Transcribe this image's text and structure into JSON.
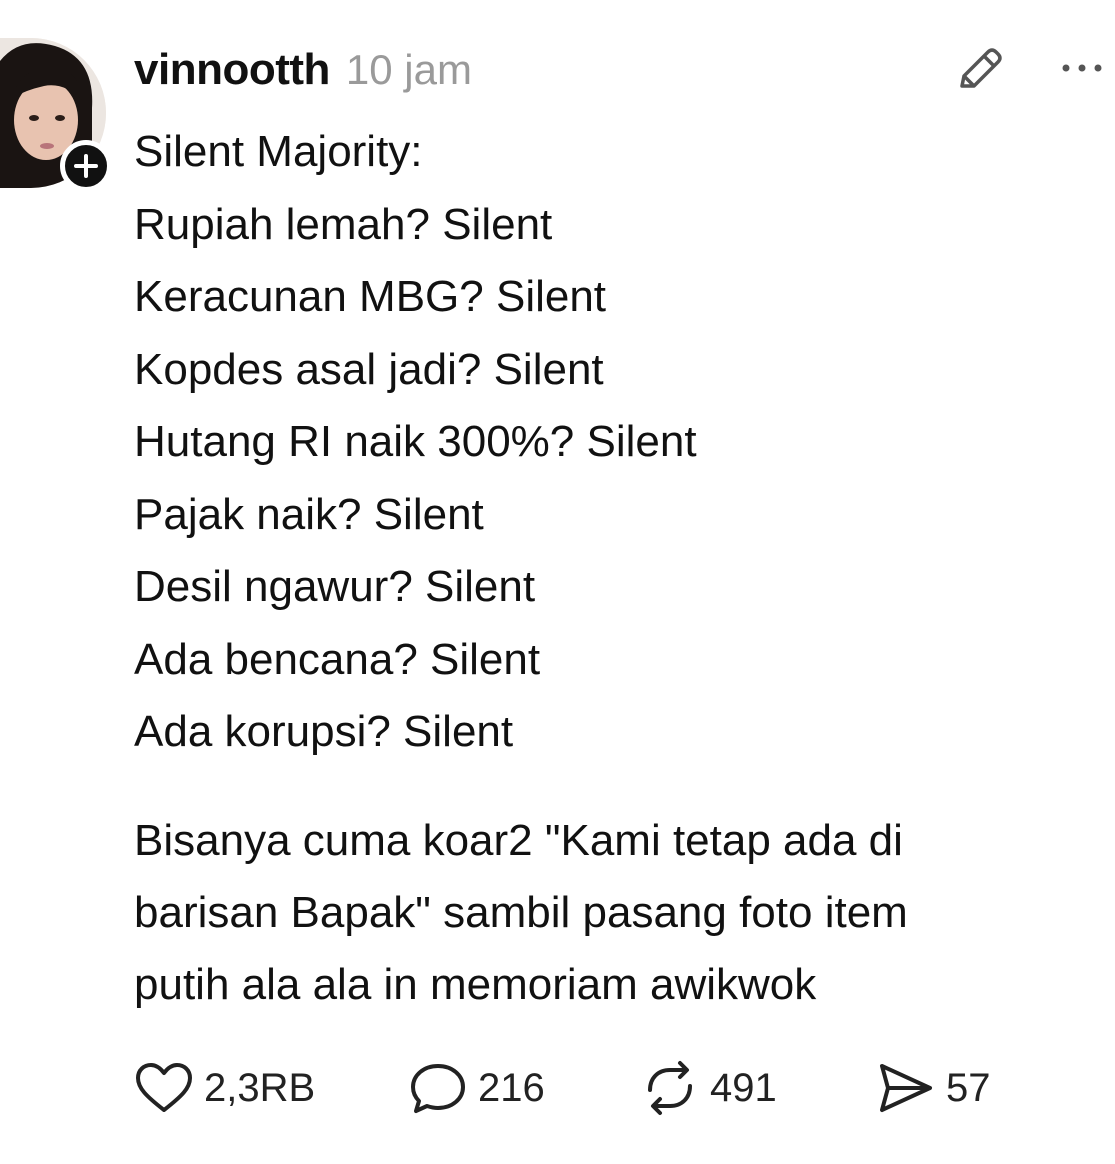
{
  "post": {
    "username": "vinnootth",
    "time_ago": "10 jam",
    "lines": [
      "Silent Majority:",
      "Rupiah lemah? Silent",
      "Keracunan MBG? Silent",
      "Kopdes asal jadi? Silent",
      "Hutang RI naik 300%? Silent",
      "Pajak naik? Silent",
      "Desil ngawur? Silent",
      "Ada bencana? Silent",
      "Ada korupsi? Silent"
    ],
    "paragraph_lines": [
      "Bisanya cuma koar2 \"Kami tetap ada di",
      "barisan Bapak\" sambil pasang foto item",
      "putih ala ala in memoriam awikwok"
    ]
  },
  "actions": {
    "likes": "2,3RB",
    "comments": "216",
    "reposts": "491",
    "shares": "57"
  },
  "icons": {
    "avatar": "profile-photo",
    "follow": "plus-icon",
    "edit": "pencil-icon",
    "more": "ellipsis-icon",
    "like": "heart-icon",
    "comment": "comment-bubble-icon",
    "repost": "repost-arrows-icon",
    "share": "send-icon"
  },
  "colors": {
    "text": "#111111",
    "muted": "#9a9a9a",
    "badge": "#111111"
  }
}
